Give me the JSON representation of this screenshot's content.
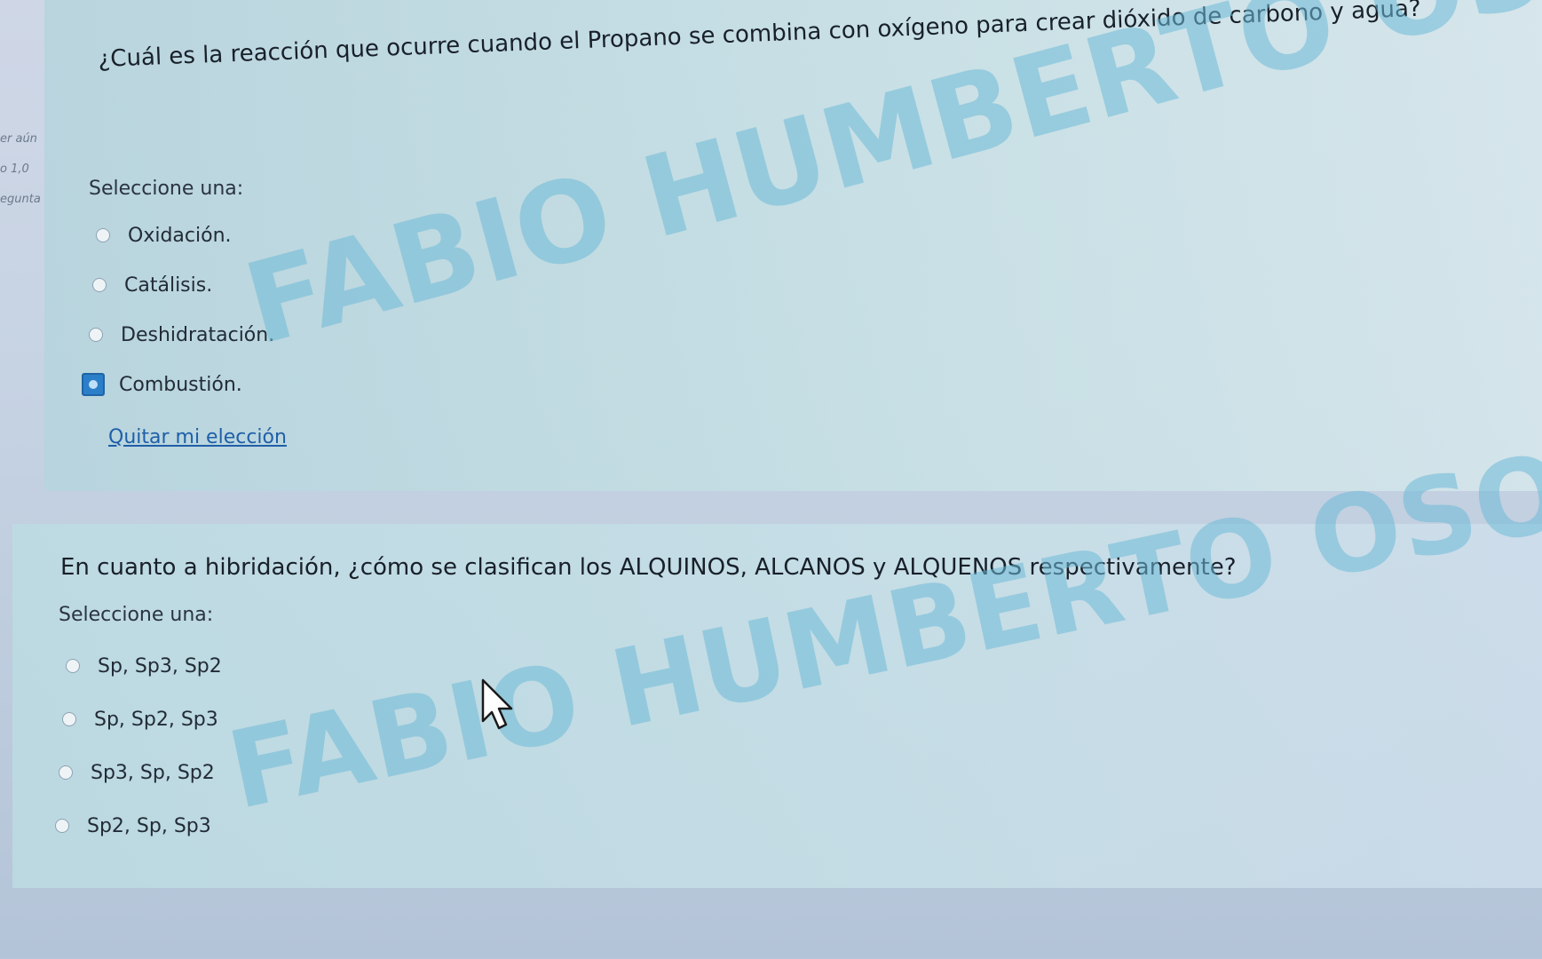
{
  "sidebar": {
    "lines": [
      "er aún",
      "o 1,0",
      "egunta"
    ]
  },
  "questions": [
    {
      "text": "¿Cuál es la reacción que ocurre cuando el Propano se combina con oxígeno para crear dióxido de carbono y agua?",
      "prompt": "Seleccione una:",
      "options": [
        "Oxidación.",
        "Catálisis.",
        "Deshidratación.",
        "Combustión."
      ],
      "selected": "Combustión.",
      "clear_choice": "Quitar mi elección"
    },
    {
      "text": "En cuanto a hibridación, ¿cómo se clasifican los ALQUINOS, ALCANOS y ALQUENOS respectivamente?",
      "prompt": "Seleccione una:",
      "options": [
        "Sp, Sp3, Sp2",
        "Sp, Sp2, Sp3",
        "Sp3, Sp, Sp2",
        "Sp2, Sp, Sp3"
      ]
    }
  ],
  "watermark": {
    "text_1": "FABIO HUMBERTO OSORIO",
    "text_2": "FABIO HUMBERTO OSORIO"
  },
  "colors": {
    "selected_radio": "#2b7ec8",
    "link": "#1f5fa8",
    "watermark": "#6eb9d7"
  },
  "icons": {
    "cursor": "mouse-pointer-icon",
    "selected_radio": "radio-checked-icon",
    "unselected_radio": "radio-unchecked-icon"
  }
}
